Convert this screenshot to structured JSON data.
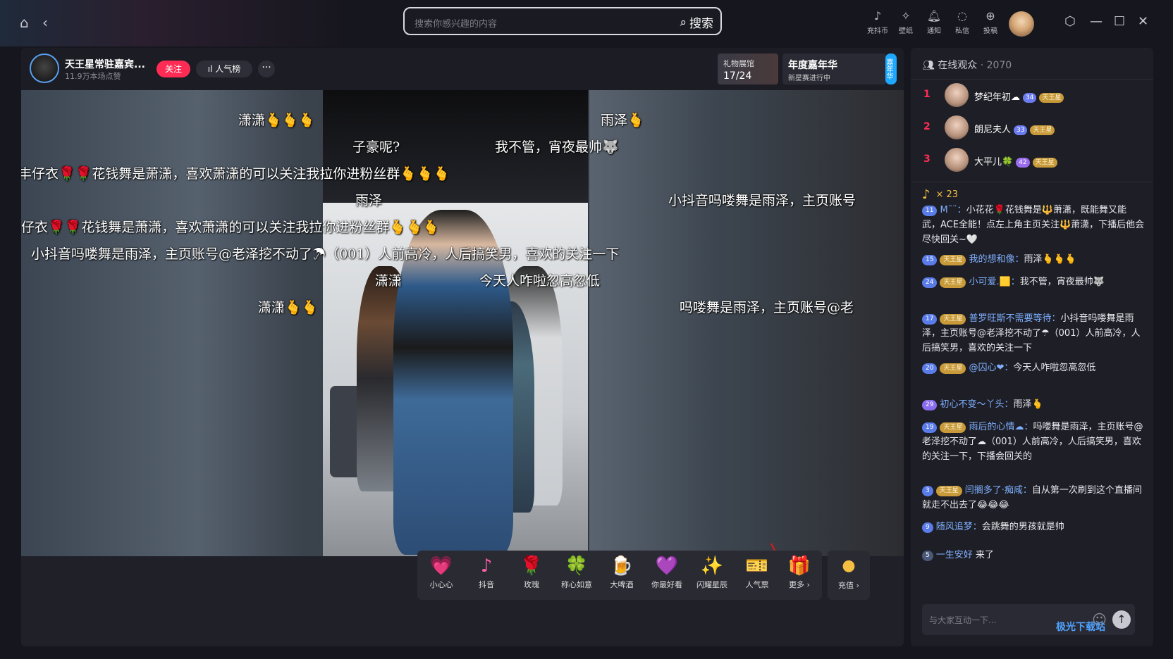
{
  "topbar": {
    "search_placeholder": "搜索你感兴趣的内容",
    "search_button": "搜索",
    "buttons": [
      {
        "label": "充抖币",
        "icon": "douyin-coin-icon"
      },
      {
        "label": "壁纸",
        "icon": "wallpaper-icon"
      },
      {
        "label": "通知",
        "icon": "bell-icon"
      },
      {
        "label": "私信",
        "icon": "chat-icon"
      },
      {
        "label": "投稿",
        "icon": "upload-icon"
      }
    ]
  },
  "anchor": {
    "name": "天王星常驻嘉宾...",
    "likes": "11.9万本场点赞",
    "follow_label": "关注",
    "rank_label": "人气榜",
    "more_label": "···"
  },
  "banners": {
    "museum_title": "礼物展馆",
    "museum_count": "17/24",
    "carnival_title": "年度嘉年华",
    "carnival_sub": "新星赛进行中",
    "carnival_tag": "嘉年华"
  },
  "danmaku": [
    "潇潇🫰🫰🫰",
    "雨泽🫰",
    "子豪呢?",
    "我不管，宵夜最帅🐺",
    "丰仔衣🌹🌹花钱舞是萧潇，喜欢萧潇的可以关注我拉你进粉丝群🫰🫰🫰",
    "雨泽",
    "小抖音吗喽舞是雨泽，主页账号",
    "仔衣🌹🌹花钱舞是萧潇，喜欢萧潇的可以关注我拉你进粉丝群🫰🫰🫰",
    "小抖音吗喽舞是雨泽，主页账号@老泽挖不动了☂（001）人前高冷，人后搞笑男，喜欢的关注一下",
    "潇潇",
    "今天人咋啦忽高忽低",
    "潇潇🫰🫰",
    "吗喽舞是雨泽，主页账号@老"
  ],
  "gifts": [
    {
      "label": "小心心",
      "icon": "heart-gift-icon",
      "glyph": "💗"
    },
    {
      "label": "抖音",
      "icon": "douyin-gift-icon",
      "glyph": "♪"
    },
    {
      "label": "玫瑰",
      "icon": "rose-gift-icon",
      "glyph": "🌹"
    },
    {
      "label": "称心如意",
      "icon": "ruyi-gift-icon",
      "glyph": "🍀"
    },
    {
      "label": "大啤酒",
      "icon": "beer-gift-icon",
      "glyph": "🍺"
    },
    {
      "label": "你最好看",
      "icon": "heart-card-gift-icon",
      "glyph": "💜"
    },
    {
      "label": "闪耀星辰",
      "icon": "star-gift-icon",
      "glyph": "✨"
    },
    {
      "label": "人气票",
      "icon": "ticket-gift-icon",
      "glyph": "🎫"
    },
    {
      "label": "更多 ›",
      "icon": "gift-box-icon",
      "glyph": "🎁"
    }
  ],
  "recharge_label": "充值 ›",
  "sidebar": {
    "online_label": "在线观众",
    "online_count": "· 2070",
    "top": [
      {
        "rank": "1",
        "name": "梦纪年初☁",
        "level": "34",
        "fan": "天王星"
      },
      {
        "rank": "2",
        "name": "朗尼夫人",
        "level": "33",
        "fan": "天王星"
      },
      {
        "rank": "3",
        "name": "大平儿🍀",
        "level": "42",
        "fan": "天王星"
      }
    ],
    "combo_text": "× 23",
    "messages": [
      {
        "level": "11",
        "fan": "",
        "user": "M¨¨：",
        "text": "小花花🌹花钱舞是🔱萧潇，既能舞又能武，ACE全能！点左上角主页关注🔱萧潇，下播后他会尽快回关~🤍"
      },
      {
        "level": "15",
        "fan": "天王星",
        "user": "我的想和像：",
        "text": "雨泽🫰🫰🫰"
      },
      {
        "level": "24",
        "fan": "天王星",
        "user": "小可爱.🟨：",
        "text": "我不管，宵夜最帅🐺"
      },
      {
        "level": "17",
        "fan": "天王星",
        "user": "普罗旺斯不需要等待：",
        "text": "小抖音吗喽舞是雨泽，主页账号@老泽挖不动了☂（001）人前高冷，人后搞笑男，喜欢的关注一下"
      },
      {
        "level": "20",
        "fan": "天王星",
        "user": "@囚心❤：",
        "text": "今天人咋啦忽高忽低"
      },
      {
        "level": "29",
        "fan": "",
        "user": "初心不变～丫头：",
        "text": "雨泽🫰"
      },
      {
        "level": "19",
        "fan": "天王星",
        "user": "雨后的心情☁：",
        "text": "吗喽舞是雨泽，主页账号@老泽挖不动了☁（001）人前高冷，人后搞笑男，喜欢的关注一下，下播会回关的"
      },
      {
        "level": "3",
        "fan": "天王星",
        "user": "闫搁多了·痴咸：",
        "text": "自从第一次刷到这个直播间就走不出去了😂😂😂"
      },
      {
        "level": "9",
        "fan": "",
        "user": "随风追梦：",
        "text": "会跳舞的男孩就是帅"
      },
      {
        "level": "5",
        "fan": "",
        "user": "一生安好",
        "text": "来了"
      }
    ],
    "input_placeholder": "与大家互动一下..."
  },
  "watermark": "极光下载站"
}
